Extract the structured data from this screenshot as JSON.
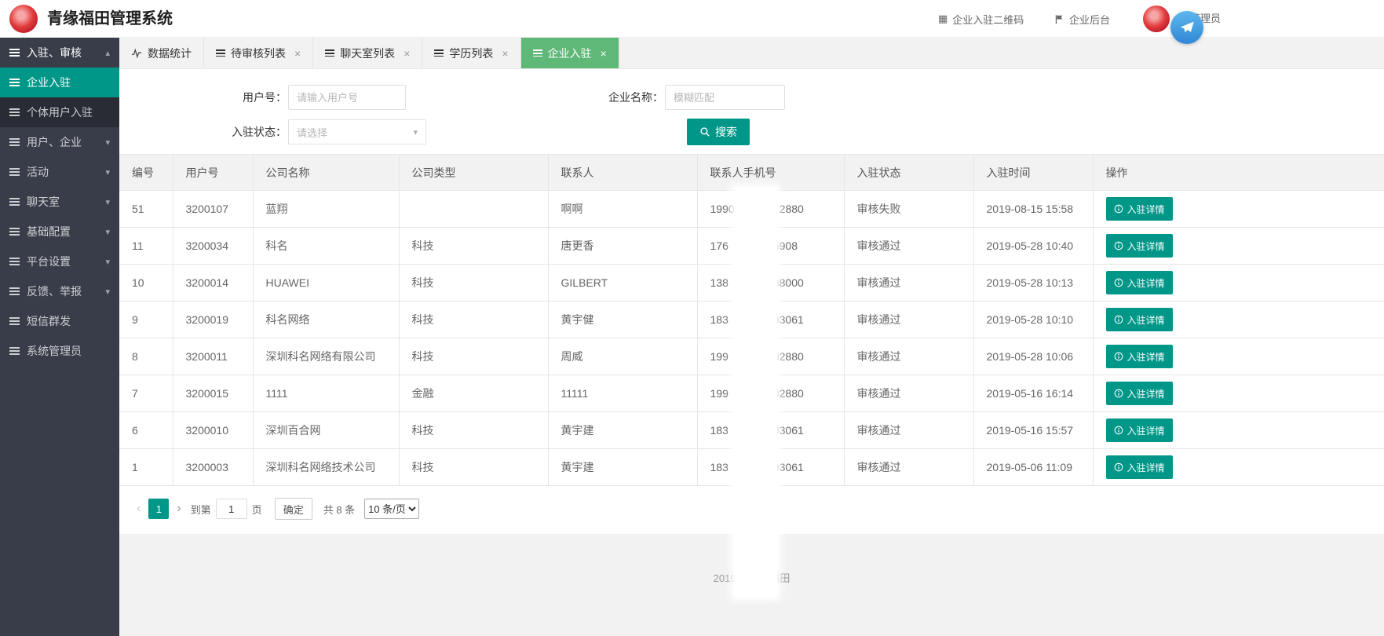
{
  "colors": {
    "accent": "#009688",
    "tab_active": "#5FB878",
    "sidebar_bg": "#393D49",
    "header_bg": "#ffffff"
  },
  "icons": {
    "caret_down": "▾",
    "caret_up": "▴",
    "close": "×",
    "qr": "▦",
    "prev": "‹",
    "next": "›"
  },
  "header": {
    "title": "青缘福田管理系统",
    "qr_link": "企业入驻二维码",
    "backend_link": "企业后台",
    "admin_label": "管理员"
  },
  "sidebar": {
    "items": [
      {
        "label": "入驻、审核"
      },
      {
        "label": "企业入驻"
      },
      {
        "label": "个体用户入驻"
      },
      {
        "label": "用户、企业"
      },
      {
        "label": "活动"
      },
      {
        "label": "聊天室"
      },
      {
        "label": "基础配置"
      },
      {
        "label": "平台设置"
      },
      {
        "label": "反馈、举报"
      },
      {
        "label": "短信群发"
      },
      {
        "label": "系统管理员"
      }
    ]
  },
  "tabs": [
    {
      "label": "数据统计"
    },
    {
      "label": "待审核列表"
    },
    {
      "label": "聊天室列表"
    },
    {
      "label": "学历列表"
    },
    {
      "label": "企业入驻"
    }
  ],
  "search": {
    "user_label": "用户号：",
    "user_placeholder": "请输入用户号",
    "company_label": "企业名称：",
    "company_placeholder": "模糊匹配",
    "status_label": "入驻状态：",
    "status_placeholder": "请选择",
    "button": "搜索"
  },
  "table": {
    "columns": [
      "编号",
      "用户号",
      "公司名称",
      "公司类型",
      "联系人",
      "联系人手机号",
      "入驻状态",
      "入驻时间",
      "操作"
    ],
    "action_label": "入驻详情",
    "rows": [
      {
        "no": "51",
        "uid": "3200107",
        "company": "蓝翔",
        "type": "",
        "contact": "啊啊",
        "phone_prefix": "1990",
        "phone_suffix": "2880",
        "status": "审核失败",
        "time": "2019-08-15 15:58"
      },
      {
        "no": "11",
        "uid": "3200034",
        "company": "科名",
        "type": "科技",
        "contact": "唐更香",
        "phone_prefix": "176",
        "phone_suffix": "5908",
        "status": "审核通过",
        "time": "2019-05-28 10:40"
      },
      {
        "no": "10",
        "uid": "3200014",
        "company": "HUAWEI",
        "type": "科技",
        "contact": "GILBERT",
        "phone_prefix": "138",
        "phone_suffix": "38000",
        "status": "审核通过",
        "time": "2019-05-28 10:13"
      },
      {
        "no": "9",
        "uid": "3200019",
        "company": "科名网络",
        "type": "科技",
        "contact": "黄宇健",
        "phone_prefix": "183",
        "phone_suffix": "93061",
        "status": "审核通过",
        "time": "2019-05-28 10:10"
      },
      {
        "no": "8",
        "uid": "3200011",
        "company": "深圳科名网络有限公司",
        "type": "科技",
        "contact": "周威",
        "phone_prefix": "199",
        "phone_suffix": "02880",
        "status": "审核通过",
        "time": "2019-05-28 10:06"
      },
      {
        "no": "7",
        "uid": "3200015",
        "company": "1111",
        "type": "金融",
        "contact": "11111",
        "phone_prefix": "199",
        "phone_suffix": "02880",
        "status": "审核通过",
        "time": "2019-05-16 16:14"
      },
      {
        "no": "6",
        "uid": "3200010",
        "company": "深圳百合网",
        "type": "科技",
        "contact": "黄宇建",
        "phone_prefix": "183",
        "phone_suffix": "93061",
        "status": "审核通过",
        "time": "2019-05-16 15:57"
      },
      {
        "no": "1",
        "uid": "3200003",
        "company": "深圳科名网络技术公司",
        "type": "科技",
        "contact": "黄宇建",
        "phone_prefix": "183",
        "phone_suffix": "93061",
        "status": "审核通过",
        "time": "2019-05-06 11:09"
      }
    ]
  },
  "pagination": {
    "page": "1",
    "goto_label": "到第",
    "goto_value": "1",
    "page_label": "页",
    "confirm": "确定",
    "total": "共 8 条",
    "page_size": "10 条/页"
  },
  "footer": {
    "text": "2019 © 青缘福田"
  }
}
